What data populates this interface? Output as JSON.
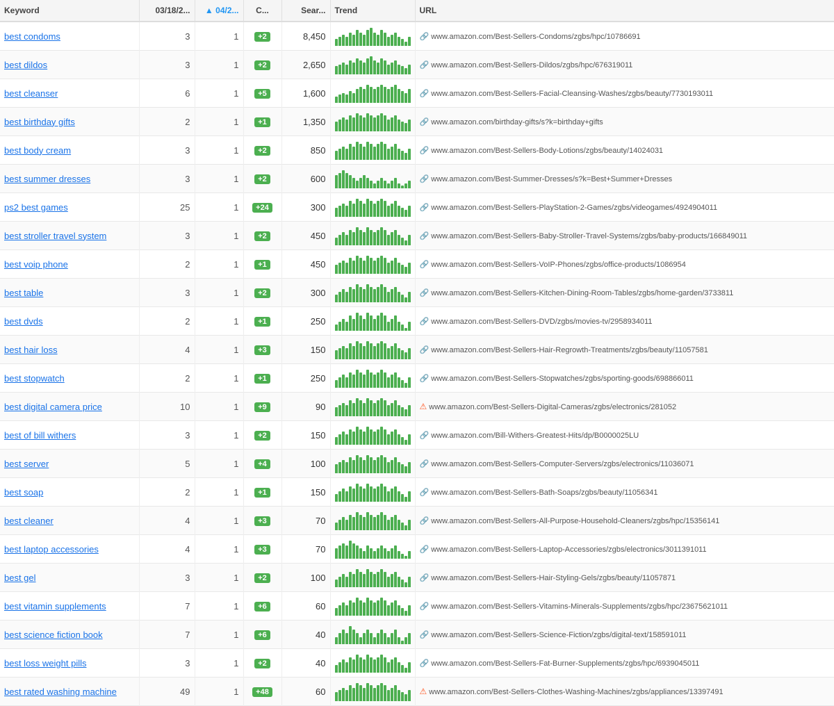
{
  "headers": {
    "keyword": "Keyword",
    "prev": "03/18/2...",
    "cur": "04/2...",
    "change": "C...",
    "search": "Sear...",
    "trend": "Trend",
    "url": "URL"
  },
  "rows": [
    {
      "keyword": "best condoms",
      "prev": 3,
      "cur": 1,
      "change": "+2",
      "change_type": "green",
      "search": "8,450",
      "trend": [
        3,
        4,
        5,
        4,
        6,
        5,
        7,
        6,
        5,
        7,
        8,
        6,
        5,
        7,
        6,
        4,
        5,
        6,
        4,
        3,
        2,
        4
      ],
      "has_warning": false,
      "url": "www.amazon.com/Best-Sellers-Condoms/zgbs/hpc/10786691"
    },
    {
      "keyword": "best dildos",
      "prev": 3,
      "cur": 1,
      "change": "+2",
      "change_type": "green",
      "search": "2,650",
      "trend": [
        4,
        5,
        6,
        5,
        7,
        6,
        8,
        7,
        6,
        8,
        9,
        7,
        6,
        8,
        7,
        5,
        6,
        7,
        5,
        4,
        3,
        5
      ],
      "has_warning": false,
      "url": "www.amazon.com/Best-Sellers-Dildos/zgbs/hpc/676319011"
    },
    {
      "keyword": "best cleanser",
      "prev": 6,
      "cur": 1,
      "change": "+5",
      "change_type": "green",
      "search": "1,600",
      "trend": [
        3,
        4,
        5,
        4,
        6,
        5,
        7,
        8,
        7,
        9,
        8,
        7,
        8,
        9,
        8,
        7,
        8,
        9,
        7,
        6,
        5,
        7
      ],
      "has_warning": false,
      "url": "www.amazon.com/Best-Sellers-Facial-Cleansing-Washes/zgbs/beauty/7730193011"
    },
    {
      "keyword": "best birthday gifts",
      "prev": 2,
      "cur": 1,
      "change": "+1",
      "change_type": "green",
      "search": "1,350",
      "trend": [
        5,
        6,
        7,
        6,
        8,
        7,
        9,
        8,
        7,
        9,
        8,
        7,
        8,
        9,
        8,
        6,
        7,
        8,
        6,
        5,
        4,
        6
      ],
      "has_warning": false,
      "url": "www.amazon.com/birthday-gifts/s?k=birthday+gifts"
    },
    {
      "keyword": "best body cream",
      "prev": 3,
      "cur": 1,
      "change": "+2",
      "change_type": "green",
      "search": "850",
      "trend": [
        4,
        5,
        6,
        5,
        7,
        6,
        8,
        7,
        6,
        8,
        7,
        6,
        7,
        8,
        7,
        5,
        6,
        7,
        5,
        4,
        3,
        5
      ],
      "has_warning": false,
      "url": "www.amazon.com/Best-Sellers-Body-Lotions/zgbs/beauty/14024031"
    },
    {
      "keyword": "best summer dresses",
      "prev": 3,
      "cur": 1,
      "change": "+2",
      "change_type": "green",
      "search": "600",
      "trend": [
        5,
        6,
        7,
        6,
        5,
        4,
        3,
        4,
        5,
        4,
        3,
        2,
        3,
        4,
        3,
        2,
        3,
        4,
        2,
        1,
        2,
        3
      ],
      "has_warning": false,
      "url": "www.amazon.com/Best-Summer-Dresses/s?k=Best+Summer+Dresses"
    },
    {
      "keyword": "ps2 best games",
      "prev": 25,
      "cur": 1,
      "change": "+24",
      "change_type": "green",
      "search": "300",
      "trend": [
        4,
        5,
        6,
        5,
        7,
        6,
        8,
        7,
        6,
        8,
        7,
        6,
        7,
        8,
        7,
        5,
        6,
        7,
        5,
        4,
        3,
        5
      ],
      "has_warning": false,
      "url": "www.amazon.com/Best-Sellers-PlayStation-2-Games/zgbs/videogames/4924904011"
    },
    {
      "keyword": "best stroller travel system",
      "prev": 3,
      "cur": 1,
      "change": "+2",
      "change_type": "green",
      "search": "450",
      "trend": [
        3,
        4,
        5,
        4,
        6,
        5,
        7,
        6,
        5,
        7,
        6,
        5,
        6,
        7,
        6,
        4,
        5,
        6,
        4,
        3,
        2,
        4
      ],
      "has_warning": false,
      "url": "www.amazon.com/Best-Sellers-Baby-Stroller-Travel-Systems/zgbs/baby-products/166849011"
    },
    {
      "keyword": "best voip phone",
      "prev": 2,
      "cur": 1,
      "change": "+1",
      "change_type": "green",
      "search": "450",
      "trend": [
        4,
        5,
        6,
        5,
        7,
        6,
        8,
        7,
        6,
        8,
        7,
        6,
        7,
        8,
        7,
        5,
        6,
        7,
        5,
        4,
        3,
        5
      ],
      "has_warning": false,
      "url": "www.amazon.com/Best-Sellers-VoIP-Phones/zgbs/office-products/1086954"
    },
    {
      "keyword": "best table",
      "prev": 3,
      "cur": 1,
      "change": "+2",
      "change_type": "green",
      "search": "300",
      "trend": [
        3,
        4,
        5,
        4,
        6,
        5,
        7,
        6,
        5,
        7,
        6,
        5,
        6,
        7,
        6,
        4,
        5,
        6,
        4,
        3,
        2,
        4
      ],
      "has_warning": false,
      "url": "www.amazon.com/Best-Sellers-Kitchen-Dining-Room-Tables/zgbs/home-garden/3733811"
    },
    {
      "keyword": "best dvds",
      "prev": 2,
      "cur": 1,
      "change": "+1",
      "change_type": "green",
      "search": "250",
      "trend": [
        2,
        3,
        4,
        3,
        5,
        4,
        6,
        5,
        4,
        6,
        5,
        4,
        5,
        6,
        5,
        3,
        4,
        5,
        3,
        2,
        1,
        3
      ],
      "has_warning": false,
      "url": "www.amazon.com/Best-Sellers-DVD/zgbs/movies-tv/2958934011"
    },
    {
      "keyword": "best hair loss",
      "prev": 4,
      "cur": 1,
      "change": "+3",
      "change_type": "green",
      "search": "150",
      "trend": [
        4,
        5,
        6,
        5,
        7,
        6,
        8,
        7,
        6,
        8,
        7,
        6,
        7,
        8,
        7,
        5,
        6,
        7,
        5,
        4,
        3,
        5
      ],
      "has_warning": false,
      "url": "www.amazon.com/Best-Sellers-Hair-Regrowth-Treatments/zgbs/beauty/11057581"
    },
    {
      "keyword": "best stopwatch",
      "prev": 2,
      "cur": 1,
      "change": "+1",
      "change_type": "green",
      "search": "250",
      "trend": [
        3,
        4,
        5,
        4,
        6,
        5,
        7,
        6,
        5,
        7,
        6,
        5,
        6,
        7,
        6,
        4,
        5,
        6,
        4,
        3,
        2,
        4
      ],
      "has_warning": false,
      "url": "www.amazon.com/Best-Sellers-Stopwatches/zgbs/sporting-goods/698866011"
    },
    {
      "keyword": "best digital camera price",
      "prev": 10,
      "cur": 1,
      "change": "+9",
      "change_type": "green",
      "search": "90",
      "trend": [
        4,
        5,
        6,
        5,
        7,
        6,
        8,
        7,
        6,
        8,
        7,
        6,
        7,
        8,
        7,
        5,
        6,
        7,
        5,
        4,
        3,
        5
      ],
      "has_warning": true,
      "url": "www.amazon.com/Best-Sellers-Digital-Cameras/zgbs/electronics/281052"
    },
    {
      "keyword": "best of bill withers",
      "prev": 3,
      "cur": 1,
      "change": "+2",
      "change_type": "green",
      "search": "150",
      "trend": [
        3,
        4,
        5,
        4,
        6,
        5,
        7,
        6,
        5,
        7,
        6,
        5,
        6,
        7,
        6,
        4,
        5,
        6,
        4,
        3,
        2,
        4
      ],
      "has_warning": false,
      "url": "www.amazon.com/Bill-Withers-Greatest-Hits/dp/B0000025LU"
    },
    {
      "keyword": "best server",
      "prev": 5,
      "cur": 1,
      "change": "+4",
      "change_type": "green",
      "search": "100",
      "trend": [
        4,
        5,
        6,
        5,
        7,
        6,
        8,
        7,
        6,
        8,
        7,
        6,
        7,
        8,
        7,
        5,
        6,
        7,
        5,
        4,
        3,
        5
      ],
      "has_warning": false,
      "url": "www.amazon.com/Best-Sellers-Computer-Servers/zgbs/electronics/11036071"
    },
    {
      "keyword": "best soap",
      "prev": 2,
      "cur": 1,
      "change": "+1",
      "change_type": "green",
      "search": "150",
      "trend": [
        3,
        4,
        5,
        4,
        6,
        5,
        7,
        6,
        5,
        7,
        6,
        5,
        6,
        7,
        6,
        4,
        5,
        6,
        4,
        3,
        2,
        4
      ],
      "has_warning": false,
      "url": "www.amazon.com/Best-Sellers-Bath-Soaps/zgbs/beauty/11056341"
    },
    {
      "keyword": "best cleaner",
      "prev": 4,
      "cur": 1,
      "change": "+3",
      "change_type": "green",
      "search": "70",
      "trend": [
        3,
        4,
        5,
        4,
        6,
        5,
        7,
        6,
        5,
        7,
        6,
        5,
        6,
        7,
        6,
        4,
        5,
        6,
        4,
        3,
        2,
        4
      ],
      "has_warning": false,
      "url": "www.amazon.com/Best-Sellers-All-Purpose-Household-Cleaners/zgbs/hpc/15356141"
    },
    {
      "keyword": "best laptop accessories",
      "prev": 4,
      "cur": 1,
      "change": "+3",
      "change_type": "green",
      "search": "70",
      "trend": [
        4,
        5,
        6,
        5,
        7,
        6,
        5,
        4,
        3,
        5,
        4,
        3,
        4,
        5,
        4,
        3,
        4,
        5,
        3,
        2,
        1,
        3
      ],
      "has_warning": false,
      "url": "www.amazon.com/Best-Sellers-Laptop-Accessories/zgbs/electronics/3011391011"
    },
    {
      "keyword": "best gel",
      "prev": 3,
      "cur": 1,
      "change": "+2",
      "change_type": "green",
      "search": "100",
      "trend": [
        3,
        4,
        5,
        4,
        6,
        5,
        7,
        6,
        5,
        7,
        6,
        5,
        6,
        7,
        6,
        4,
        5,
        6,
        4,
        3,
        2,
        4
      ],
      "has_warning": false,
      "url": "www.amazon.com/Best-Sellers-Hair-Styling-Gels/zgbs/beauty/11057871"
    },
    {
      "keyword": "best vitamin supplements",
      "prev": 7,
      "cur": 1,
      "change": "+6",
      "change_type": "green",
      "search": "60",
      "trend": [
        3,
        4,
        5,
        4,
        6,
        5,
        7,
        6,
        5,
        7,
        6,
        5,
        6,
        7,
        6,
        4,
        5,
        6,
        4,
        3,
        2,
        4
      ],
      "has_warning": false,
      "url": "www.amazon.com/Best-Sellers-Vitamins-Minerals-Supplements/zgbs/hpc/23675621011"
    },
    {
      "keyword": "best science fiction book",
      "prev": 7,
      "cur": 1,
      "change": "+6",
      "change_type": "green",
      "search": "40",
      "trend": [
        2,
        3,
        4,
        3,
        5,
        4,
        3,
        2,
        3,
        4,
        3,
        2,
        3,
        4,
        3,
        2,
        3,
        4,
        2,
        1,
        2,
        3
      ],
      "has_warning": false,
      "url": "www.amazon.com/Best-Sellers-Science-Fiction/zgbs/digital-text/158591011"
    },
    {
      "keyword": "best loss weight pills",
      "prev": 3,
      "cur": 1,
      "change": "+2",
      "change_type": "green",
      "search": "40",
      "trend": [
        3,
        4,
        5,
        4,
        6,
        5,
        7,
        6,
        5,
        7,
        6,
        5,
        6,
        7,
        6,
        4,
        5,
        6,
        4,
        3,
        2,
        4
      ],
      "has_warning": false,
      "url": "www.amazon.com/Best-Sellers-Fat-Burner-Supplements/zgbs/hpc/6939045011"
    },
    {
      "keyword": "best rated washing machine",
      "prev": 49,
      "cur": 1,
      "change": "+48",
      "change_type": "green",
      "search": "60",
      "trend": [
        4,
        5,
        6,
        5,
        7,
        6,
        8,
        7,
        6,
        8,
        7,
        6,
        7,
        8,
        7,
        5,
        6,
        7,
        5,
        4,
        3,
        5
      ],
      "has_warning": true,
      "url": "www.amazon.com/Best-Sellers-Clothes-Washing-Machines/zgbs/appliances/13397491"
    }
  ]
}
